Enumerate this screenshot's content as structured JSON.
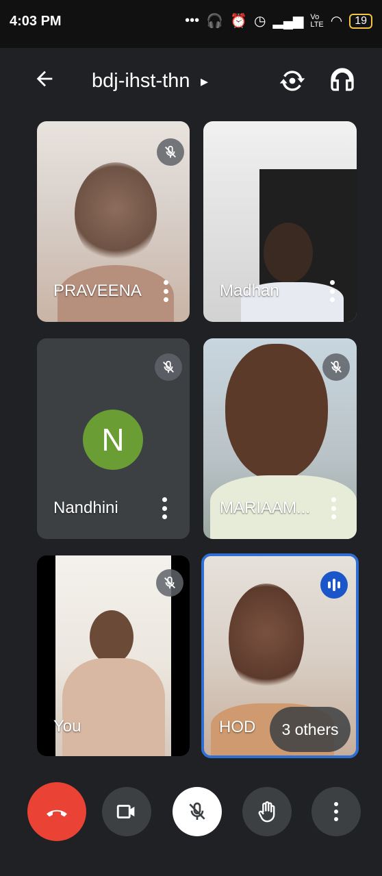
{
  "status_bar": {
    "time": "4:03 PM",
    "icons": [
      "overflow-dots-icon",
      "headset-icon",
      "alarm-off-icon",
      "clock-icon",
      "signal-icon",
      "volte-icon",
      "wifi-icon"
    ],
    "battery": "19"
  },
  "header": {
    "meeting_code": "bdj-ihst-thn",
    "caret": "▸"
  },
  "participants": [
    {
      "name": "PRAVEENA",
      "muted": true,
      "video": true
    },
    {
      "name": "Madhan",
      "muted": false,
      "video": true
    },
    {
      "name": "Nandhini",
      "muted": true,
      "video": false,
      "avatar_letter": "N",
      "avatar_color": "#6a9e35"
    },
    {
      "name": "MARIAAM...",
      "muted": true,
      "video": true
    },
    {
      "name": "You",
      "muted": true,
      "video": true
    },
    {
      "name": "HOD",
      "muted": false,
      "speaking": true,
      "video": true,
      "border_color": "#2f6fd1"
    }
  ],
  "others_label": "3 others",
  "controls": {
    "end_call_color": "#ea4335",
    "items": [
      "end-call",
      "camera",
      "microphone",
      "raise-hand",
      "more-options"
    ]
  }
}
